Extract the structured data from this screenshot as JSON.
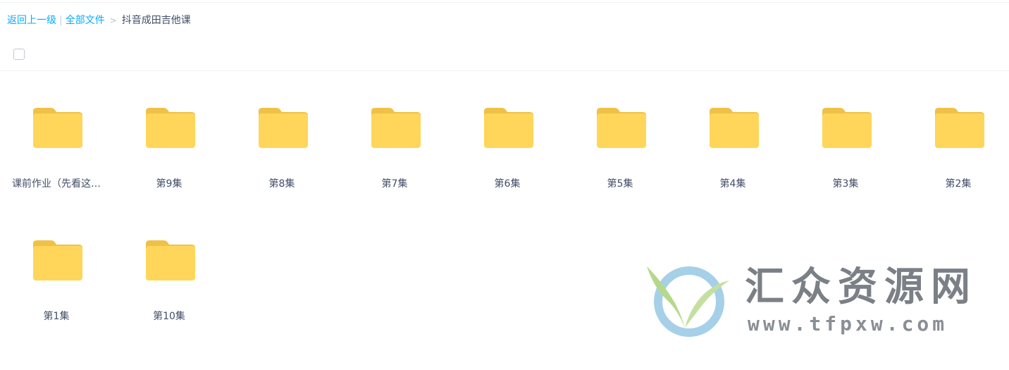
{
  "breadcrumb": {
    "back_label": "返回上一级",
    "separator": "|",
    "root_label": "全部文件",
    "arrow": ">",
    "current_label": "抖音成田吉他课"
  },
  "folders": [
    {
      "name": "课前作业（先看这…"
    },
    {
      "name": "第9集"
    },
    {
      "name": "第8集"
    },
    {
      "name": "第7集"
    },
    {
      "name": "第6集"
    },
    {
      "name": "第5集"
    },
    {
      "name": "第4集"
    },
    {
      "name": "第3集"
    },
    {
      "name": "第2集"
    },
    {
      "name": "第1集"
    },
    {
      "name": "第10集"
    }
  ],
  "watermark": {
    "title": "汇众资源网",
    "url": "www.tfpxw.com"
  },
  "colors": {
    "link": "#09aaff",
    "text": "#424e67",
    "folder_body": "#ffd659",
    "folder_tab": "#f0c146"
  },
  "icons": {
    "folder": "folder-icon",
    "checkbox": "select-all-checkbox"
  }
}
